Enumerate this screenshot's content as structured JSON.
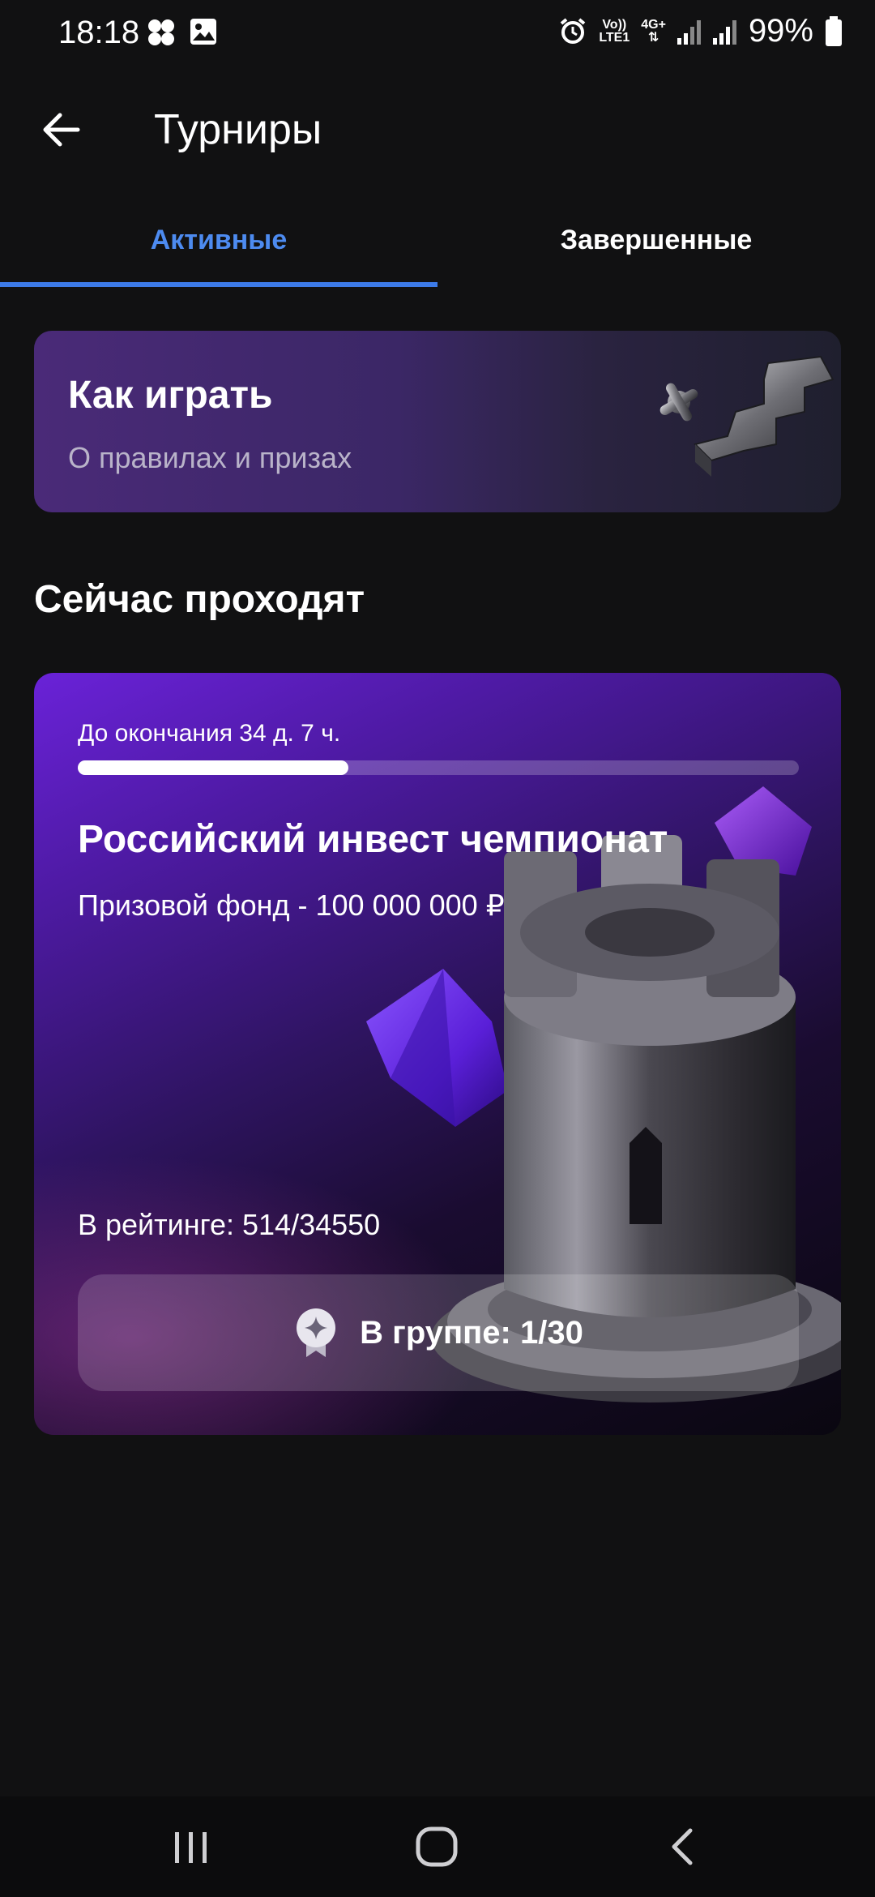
{
  "status_bar": {
    "time": "18:18",
    "battery": "99%",
    "volte_label_top": "Vo))",
    "volte_label_bottom": "LTE1",
    "net_label": "4G+",
    "icons": [
      "notification-dots-icon",
      "gallery-icon",
      "alarm-icon",
      "signal-icon",
      "signal-icon",
      "battery-icon"
    ]
  },
  "header": {
    "title": "Турниры",
    "back_icon": "arrow-left-icon"
  },
  "tabs": [
    {
      "label": "Активные",
      "active": true
    },
    {
      "label": "Завершенные",
      "active": false
    }
  ],
  "howto": {
    "title": "Как играть",
    "subtitle": "О правилах и призах"
  },
  "section": {
    "title": "Сейчас проходят"
  },
  "tournament": {
    "countdown": "До окончания 34 д. 7 ч.",
    "progress": 0.375,
    "title": "Российский инвест чемпионат",
    "prize": "Призовой фонд - 100 000 000 ₽",
    "rating": "В рейтинге: 514/34550",
    "group_button": "В группе: 1/30",
    "group_icon": "star-badge-icon"
  },
  "colors": {
    "accent": "#3d7be8",
    "background": "#111112"
  },
  "navbar": {
    "icons": [
      "recent-apps-icon",
      "home-icon",
      "back-icon"
    ]
  }
}
